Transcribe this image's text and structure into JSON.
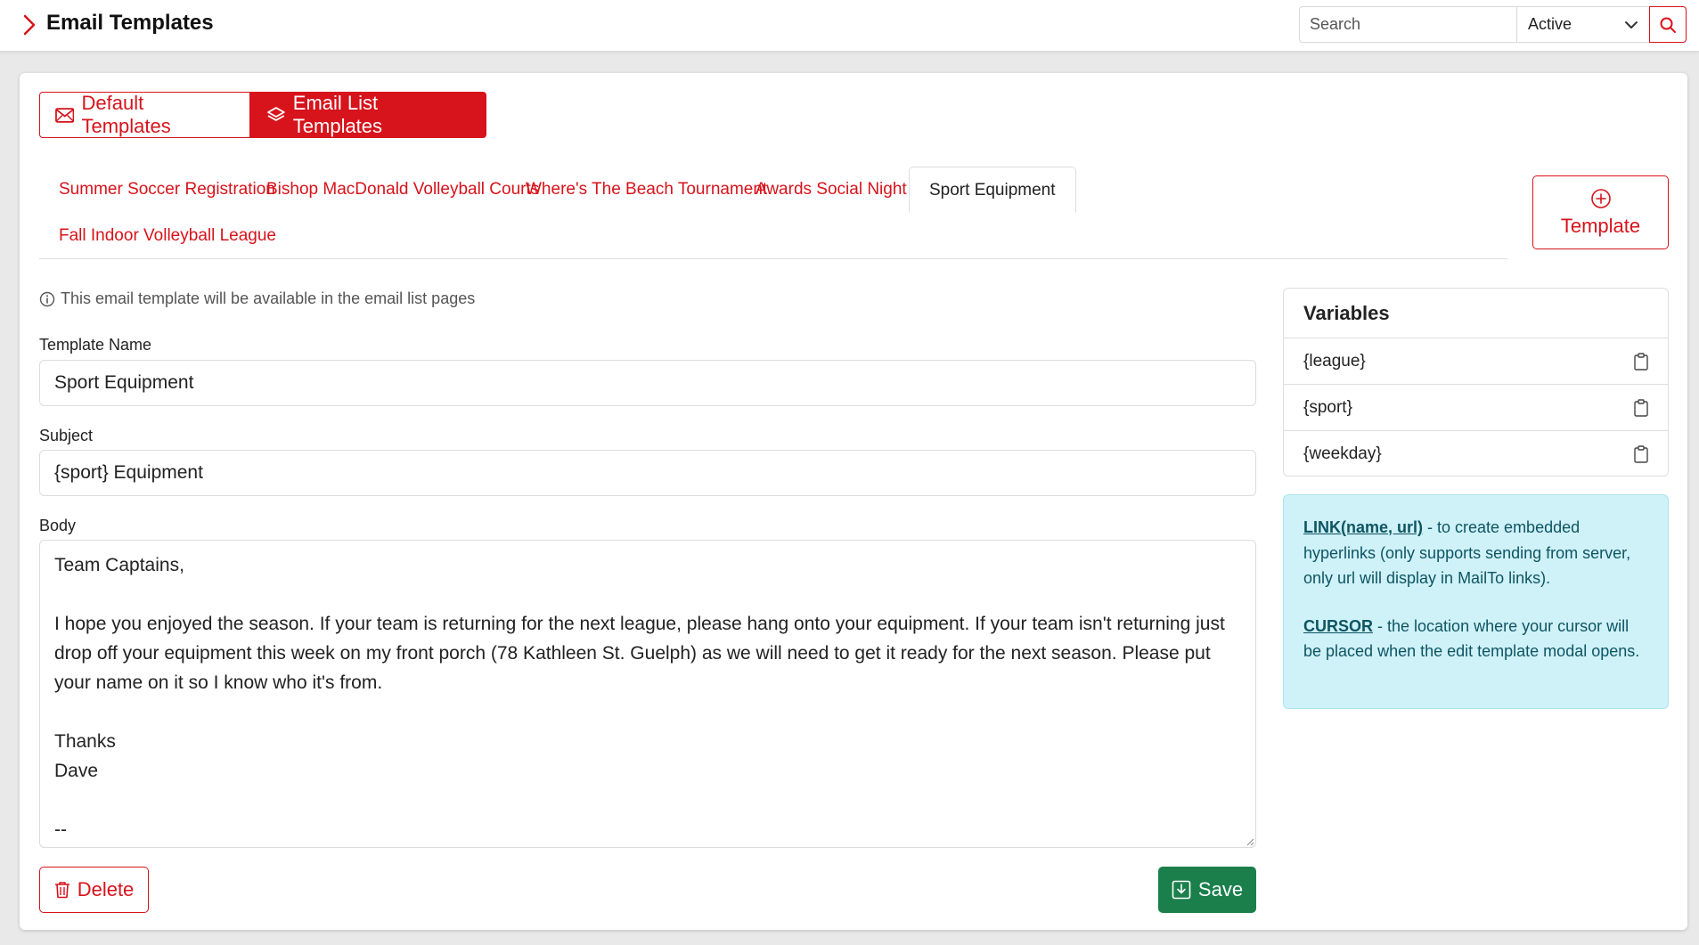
{
  "header": {
    "title": "Email Templates",
    "search_placeholder": "Search",
    "status_selected": "Active"
  },
  "template_type_toggle": {
    "default_label": "Default Templates",
    "list_label": "Email List Templates",
    "active": "Email List Templates"
  },
  "template_tabs": [
    {
      "label": "Summer Soccer Registration"
    },
    {
      "label": "Bishop MacDonald Volleyball Courts"
    },
    {
      "label": "Where's The Beach Tournament"
    },
    {
      "label": "Awards Social Night"
    },
    {
      "label": "Sport Equipment"
    },
    {
      "label": "Fall Indoor Volleyball League"
    }
  ],
  "active_tab": "Sport Equipment",
  "add_template_label": "Template",
  "form": {
    "info_text": "This email template will be available in the email list pages",
    "name_label": "Template Name",
    "name_value": "Sport Equipment",
    "subject_label": "Subject",
    "subject_value": "{sport} Equipment",
    "body_label": "Body",
    "body_value": "Team Captains,\n\nI hope you enjoyed the season. If your team is returning for the next league, please hang onto your equipment. If your team isn't returning just drop off your equipment this week on my front porch (78 Kathleen St. Guelph) as we will need to get it ready for the next season. Please put your name on it so I know who it's from.\n\nThanks\nDave\n\n--\nDave Hall"
  },
  "actions": {
    "delete_label": "Delete",
    "save_label": "Save"
  },
  "variables": {
    "title": "Variables",
    "items": [
      "{league}",
      "{sport}",
      "{weekday}"
    ]
  },
  "help": {
    "link_keyword": "LINK(name, url)",
    "link_text": " - to create embedded hyperlinks (only supports sending from server, only url will display in MailTo links).",
    "cursor_keyword": "CURSOR",
    "cursor_text": " - the location where your cursor will be placed when the edit template modal opens."
  },
  "colors": {
    "brand_red": "#d7131b",
    "save_green": "#1a7f4b",
    "help_bg": "#cff1f8"
  }
}
